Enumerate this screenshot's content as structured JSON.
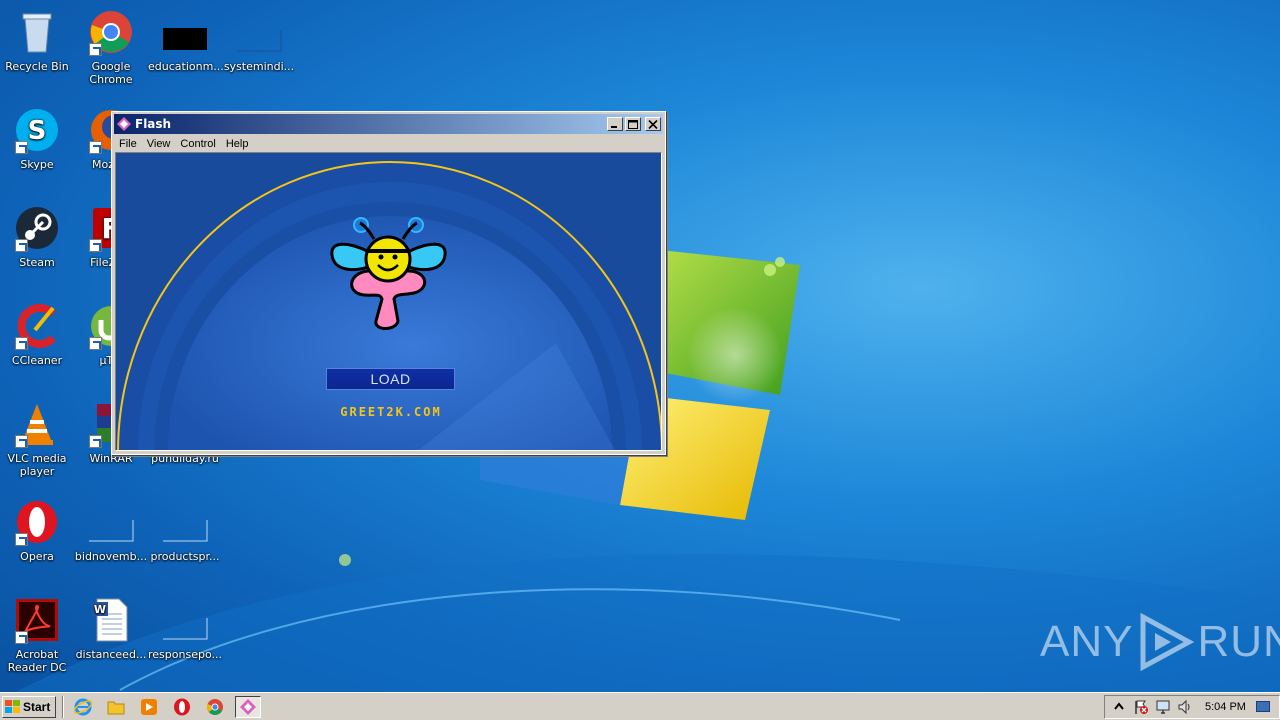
{
  "desktop": {
    "icons": [
      {
        "label": "Recycle Bin"
      },
      {
        "label": "Google Chrome"
      },
      {
        "label": "educationm..."
      },
      {
        "label": "systemindi..."
      },
      {
        "label": "Skype"
      },
      {
        "label": "Mozilla"
      },
      {
        "label": "Steam"
      },
      {
        "label": "FileZilla"
      },
      {
        "label": "CCleaner"
      },
      {
        "label": "µTor"
      },
      {
        "label": "VLC media player"
      },
      {
        "label": "WinRAR"
      },
      {
        "label": "pundiiday.ru"
      },
      {
        "label": "Opera"
      },
      {
        "label": "bidnovemb..."
      },
      {
        "label": "productspr..."
      },
      {
        "label": "Acrobat Reader DC"
      },
      {
        "label": "distanceed..."
      },
      {
        "label": "responsepo..."
      }
    ]
  },
  "window": {
    "title": "Flash",
    "menu": [
      "File",
      "View",
      "Control",
      "Help"
    ],
    "load_label": "LOAD",
    "site_text": "GREET2K.COM",
    "colors": {
      "stage": "#184b9c",
      "arc": "#f5c518"
    }
  },
  "taskbar": {
    "start_label": "Start",
    "clock": "5:04 PM",
    "pinned": [
      "internet-explorer-icon",
      "explorer-icon",
      "media-player-icon",
      "opera-icon",
      "chrome-icon",
      "flash-icon"
    ]
  },
  "watermark": {
    "left": "ANY",
    "right": "RUN"
  }
}
